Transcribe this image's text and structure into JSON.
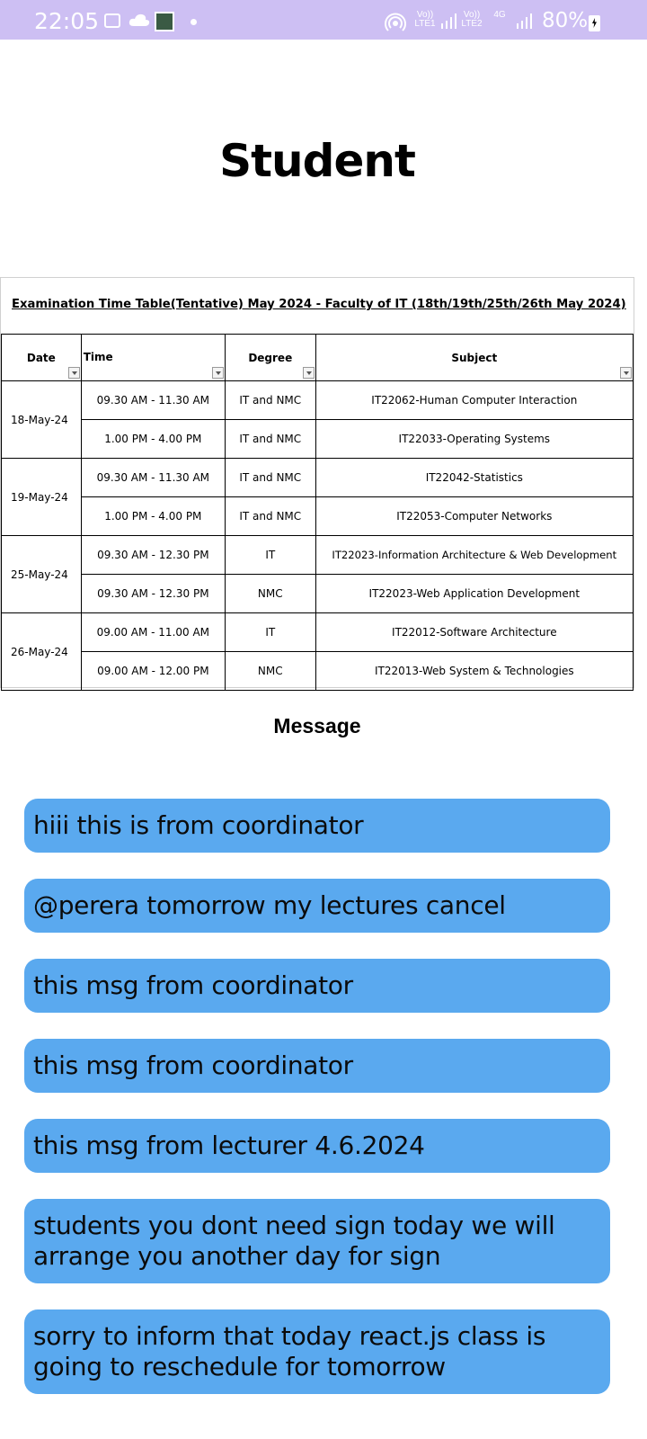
{
  "status_bar": {
    "time": "22:05",
    "sim1_label": "Vo)) LTE1",
    "sim2_label": "Vo)) LTE2",
    "sim2_network": "4G",
    "battery": "80%"
  },
  "page": {
    "title": "Student"
  },
  "timetable": {
    "caption": "Examination Time Table(Tentative) May 2024 - Faculty of IT (18th/19th/25th/26th May 2024)",
    "headers": [
      "Date",
      "Time",
      "Degree",
      "Subject"
    ],
    "groups": [
      {
        "date": "18-May-24",
        "rows": [
          {
            "time": "09.30 AM - 11.30 AM",
            "degree": "IT and NMC",
            "subject": "IT22062-Human Computer Interaction"
          },
          {
            "time": "1.00 PM - 4.00 PM",
            "degree": "IT and NMC",
            "subject": "IT22033-Operating Systems"
          }
        ]
      },
      {
        "date": "19-May-24",
        "rows": [
          {
            "time": "09.30 AM - 11.30 AM",
            "degree": "IT and NMC",
            "subject": "IT22042-Statistics"
          },
          {
            "time": "1.00 PM - 4.00 PM",
            "degree": "IT and NMC",
            "subject": "IT22053-Computer Networks"
          }
        ]
      },
      {
        "date": "25-May-24",
        "rows": [
          {
            "time": "09.30 AM - 12.30 PM",
            "degree": "IT",
            "subject": "IT22023-Information Architecture & Web Development"
          },
          {
            "time": "09.30 AM - 12.30 PM",
            "degree": "NMC",
            "subject": "IT22023-Web Application Development"
          }
        ]
      },
      {
        "date": "26-May-24",
        "rows": [
          {
            "time": "09.00 AM - 11.00 AM",
            "degree": "IT",
            "subject": "IT22012-Software Architecture"
          },
          {
            "time": "09.00 AM - 12.00 PM",
            "degree": "NMC",
            "subject": "IT22013-Web System & Technologies"
          }
        ]
      }
    ]
  },
  "messages": {
    "heading": "Message",
    "items": [
      "hiii this is from coordinator",
      "@perera tomorrow my lectures cancel",
      "this msg from coordinator",
      "this msg from coordinator",
      "this msg from lecturer 4.6.2024",
      "students you dont need sign today we will arrange you another day for sign",
      "sorry to inform that today react.js class is going to reschedule for tomorrow"
    ]
  },
  "colors": {
    "status_bar": "#cdbff3",
    "message_bubble": "#5aa9ef"
  }
}
